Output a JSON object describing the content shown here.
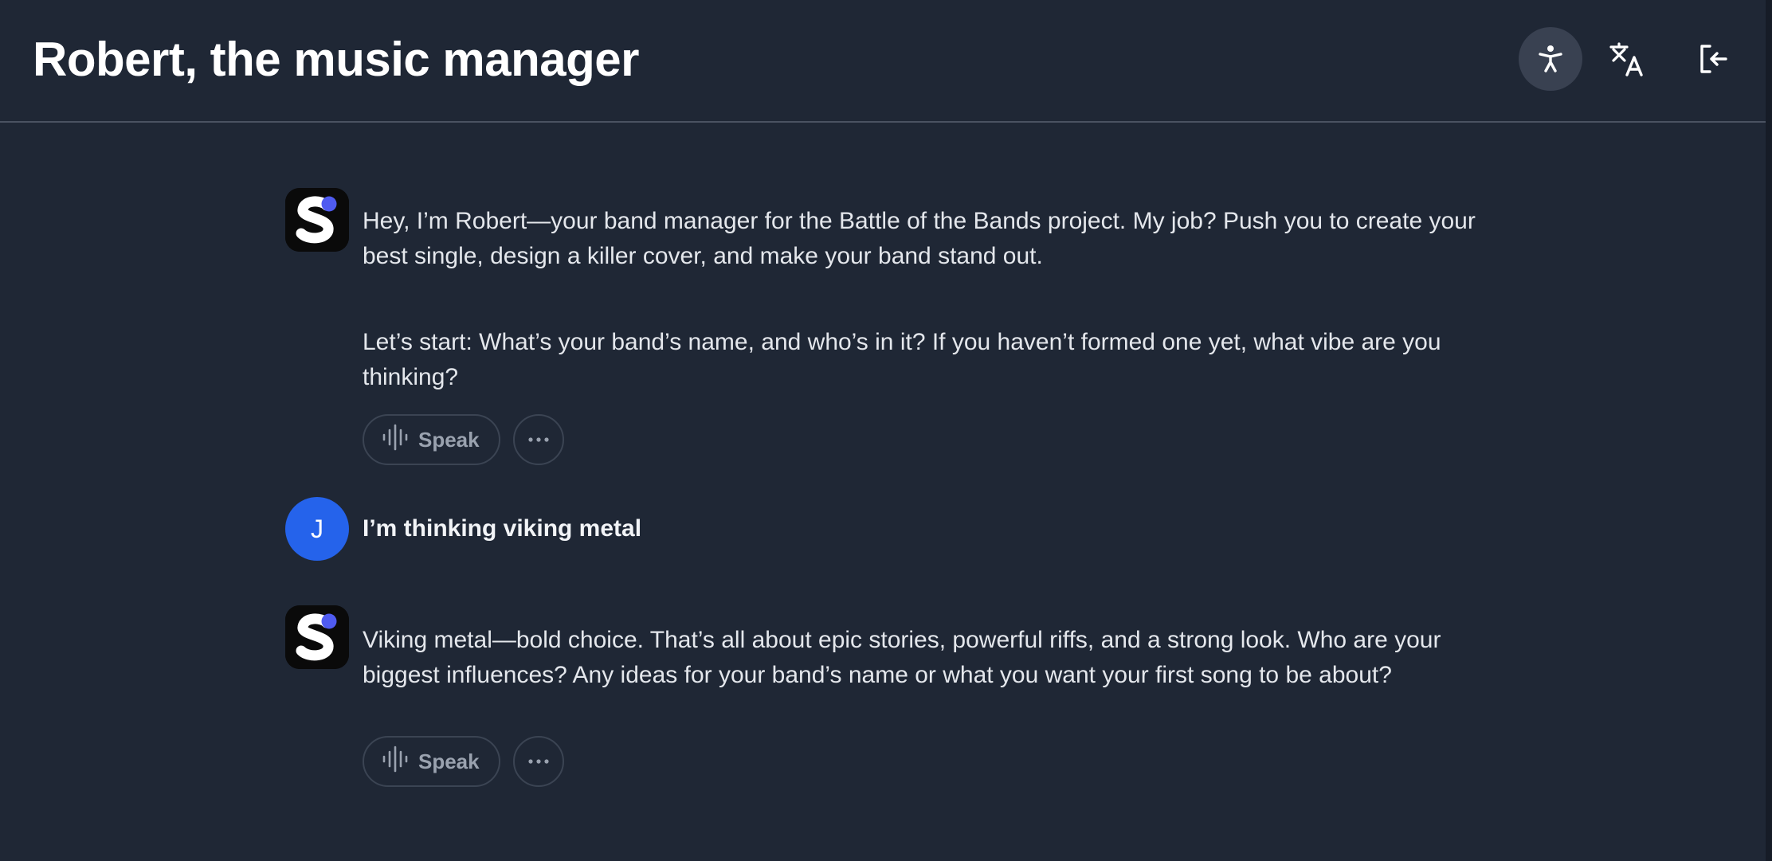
{
  "header": {
    "title": "Robert, the music manager",
    "icons": [
      "accessibility-icon",
      "translate-icon",
      "logout-icon"
    ]
  },
  "messages": [
    {
      "sender": "assistant",
      "avatar_icon": "app-logo-s",
      "paragraphs": [
        "Hey, I’m Robert—your band manager for the Battle of the Bands project. My job? Push you to create your best single, design a killer cover, and make your band stand out.",
        "Let’s start: What’s your band’s name, and who’s in it? If you haven’t formed one yet, what vibe are you thinking?"
      ],
      "speak_label": "Speak"
    },
    {
      "sender": "user",
      "avatar_initial": "J",
      "text": "I’m thinking viking metal"
    },
    {
      "sender": "assistant",
      "avatar_icon": "app-logo-s",
      "paragraphs": [
        "Viking metal—bold choice. That’s all about epic stories, powerful riffs, and a strong look. Who are your biggest influences? Any ideas for your band’s name or what you want your first song to be about?"
      ],
      "speak_label": "Speak"
    }
  ],
  "colors": {
    "background": "#1f2735",
    "user_avatar": "#2563eb",
    "logo_dot": "#4f5bf0",
    "active_button": "#394151"
  }
}
